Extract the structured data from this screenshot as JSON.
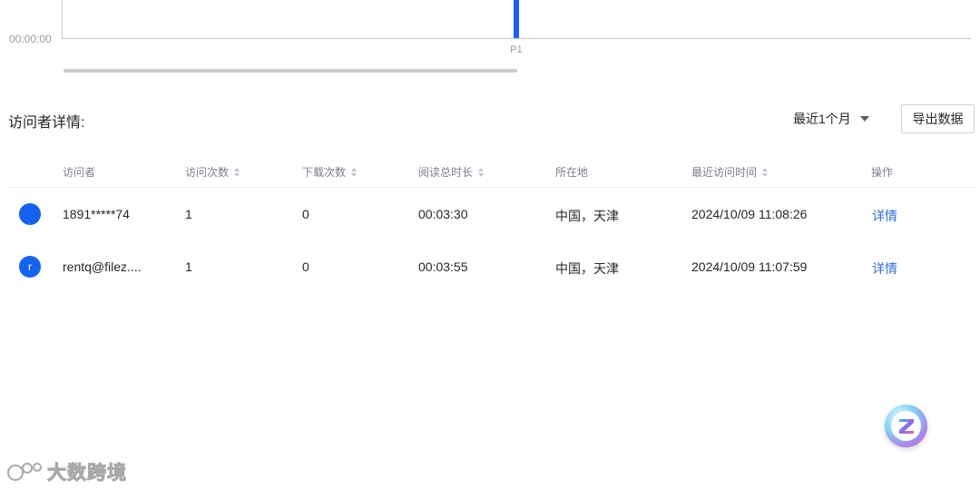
{
  "chart_data": {
    "type": "bar",
    "y_tick_labels": [
      "00:00:00"
    ],
    "categories": [
      "P1"
    ],
    "values": [
      1
    ],
    "ylim": [
      0,
      1
    ]
  },
  "visitor_section": {
    "title": "访问者详情:",
    "range_select": "最近1个月",
    "export_button": "导出数据"
  },
  "table": {
    "headers": {
      "visitor": "访问者",
      "visits": "访问次数",
      "downloads": "下载次数",
      "read_duration": "阅读总时长",
      "location": "所在地",
      "last_visit": "最近访问时间",
      "action": "操作"
    },
    "rows": [
      {
        "avatar": "",
        "visitor": "1891*****74",
        "visits": "1",
        "downloads": "0",
        "read_duration": "00:03:30",
        "location": "中国，天津",
        "last_visit": "2024/10/09 11:08:26",
        "action": "详情"
      },
      {
        "avatar": "r",
        "visitor": "rentq@filez....",
        "visits": "1",
        "downloads": "0",
        "read_duration": "00:03:55",
        "location": "中国，天津",
        "last_visit": "2024/10/09 11:07:59",
        "action": "详情"
      }
    ]
  },
  "watermark": {
    "text": "大数跨境"
  },
  "colors": {
    "accent": "#1363f2",
    "link": "#2a6be8",
    "bar": "#1a5cff"
  },
  "icons": {
    "fab": "z-logo-icon",
    "watermark": "watermark-logo-icon"
  }
}
